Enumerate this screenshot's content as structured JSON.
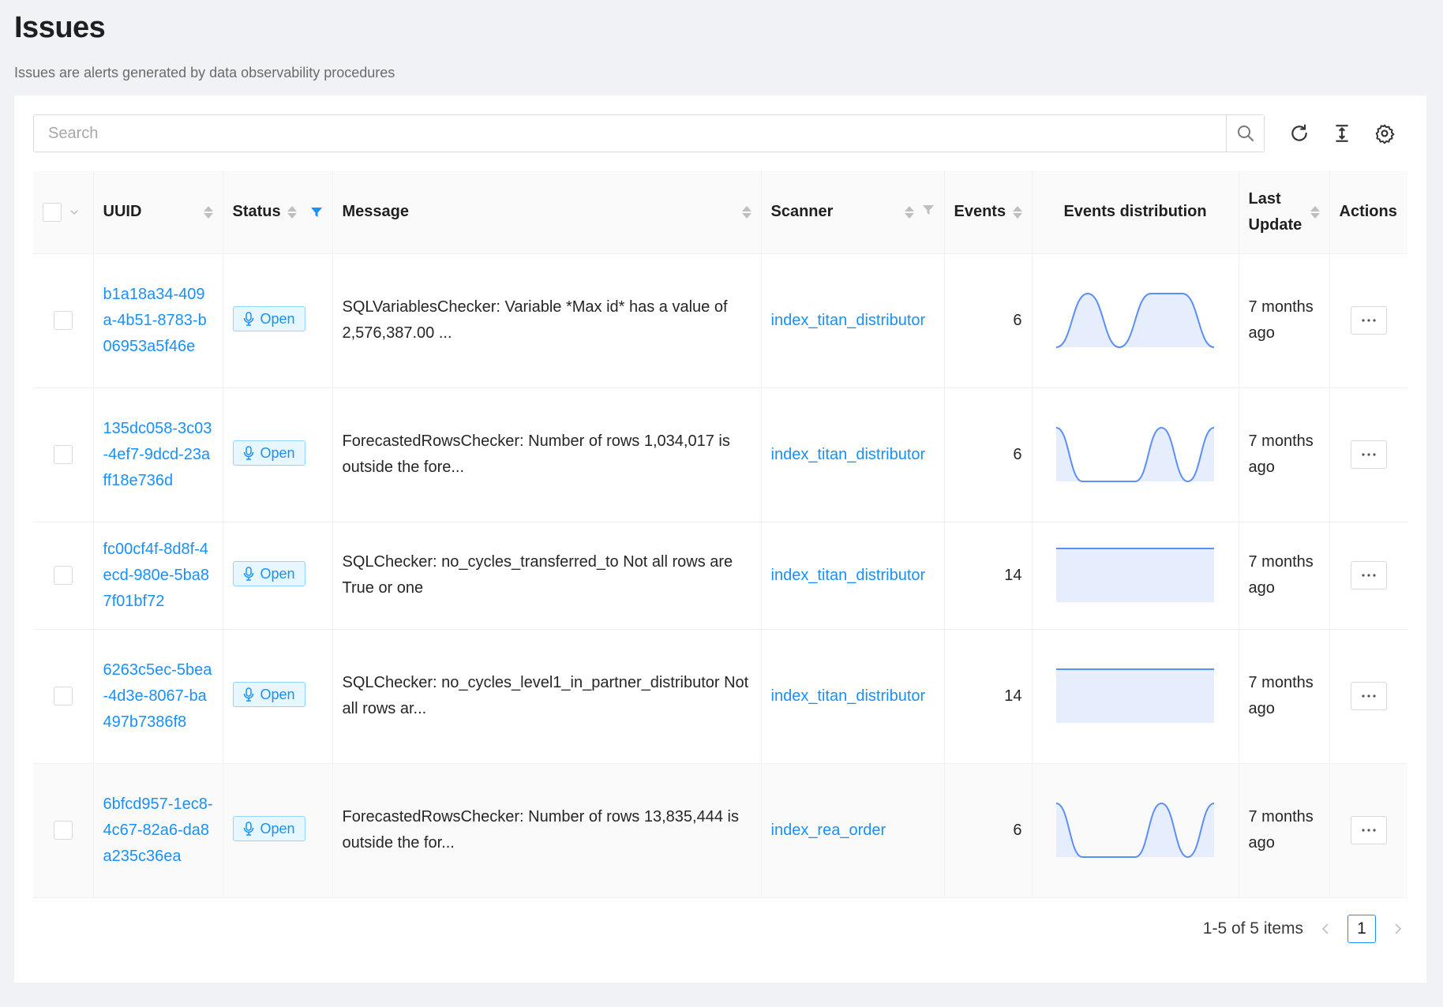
{
  "page": {
    "title": "Issues",
    "subtitle": "Issues are alerts generated by data observability procedures"
  },
  "search": {
    "placeholder": "Search"
  },
  "toolbar": {
    "icons": [
      "search-icon",
      "refresh-icon",
      "column-height-icon",
      "settings-icon"
    ]
  },
  "table": {
    "columns": {
      "uuid": "UUID",
      "status": "Status",
      "message": "Message",
      "scanner": "Scanner",
      "events": "Events",
      "distribution": "Events distribution",
      "last_update": "Last Update",
      "actions": "Actions"
    },
    "rows": [
      {
        "uuid": "b1a18a34-409a-4b51-8783-b06953a5f46e",
        "status": "Open",
        "message": "SQLVariablesChecker: Variable *Max id* has a value of 2,576,387.00 ...",
        "scanner": "index_titan_distributor",
        "events": "6",
        "last_update": "7 months ago",
        "distribution": [
          0,
          1,
          0,
          1,
          1,
          0
        ]
      },
      {
        "uuid": "135dc058-3c03-4ef7-9dcd-23aff18e736d",
        "status": "Open",
        "message": "ForecastedRowsChecker: Number of rows 1,034,017 is outside the fore...",
        "scanner": "index_titan_distributor",
        "events": "6",
        "last_update": "7 months ago",
        "distribution": [
          1,
          0,
          0,
          0,
          1,
          0,
          1
        ]
      },
      {
        "uuid": "fc00cf4f-8d8f-4ecd-980e-5ba87f01bf72",
        "status": "Open",
        "message": "SQLChecker: no_cycles_transferred_to Not all rows are True or one",
        "scanner": "index_titan_distributor",
        "events": "14",
        "last_update": "7 months ago",
        "distribution": [
          1,
          1
        ]
      },
      {
        "uuid": "6263c5ec-5bea-4d3e-8067-ba497b7386f8",
        "status": "Open",
        "message": "SQLChecker: no_cycles_level1_in_partner_distributor Not all rows ar...",
        "scanner": "index_titan_distributor",
        "events": "14",
        "last_update": "7 months ago",
        "distribution": [
          1,
          1
        ]
      },
      {
        "uuid": "6bfcd957-1ec8-4c67-82a6-da8a235c36ea",
        "status": "Open",
        "message": "ForecastedRowsChecker: Number of rows 13,835,444 is outside the for...",
        "scanner": "index_rea_order",
        "events": "6",
        "last_update": "7 months ago",
        "distribution": [
          1,
          0,
          0,
          0,
          1,
          0,
          1
        ]
      }
    ]
  },
  "pagination": {
    "summary": "1-5 of 5 items",
    "current": "1"
  },
  "colors": {
    "primary": "#1890ff",
    "spark_fill": "#e6edfc",
    "spark_line": "#5b8ff9"
  }
}
